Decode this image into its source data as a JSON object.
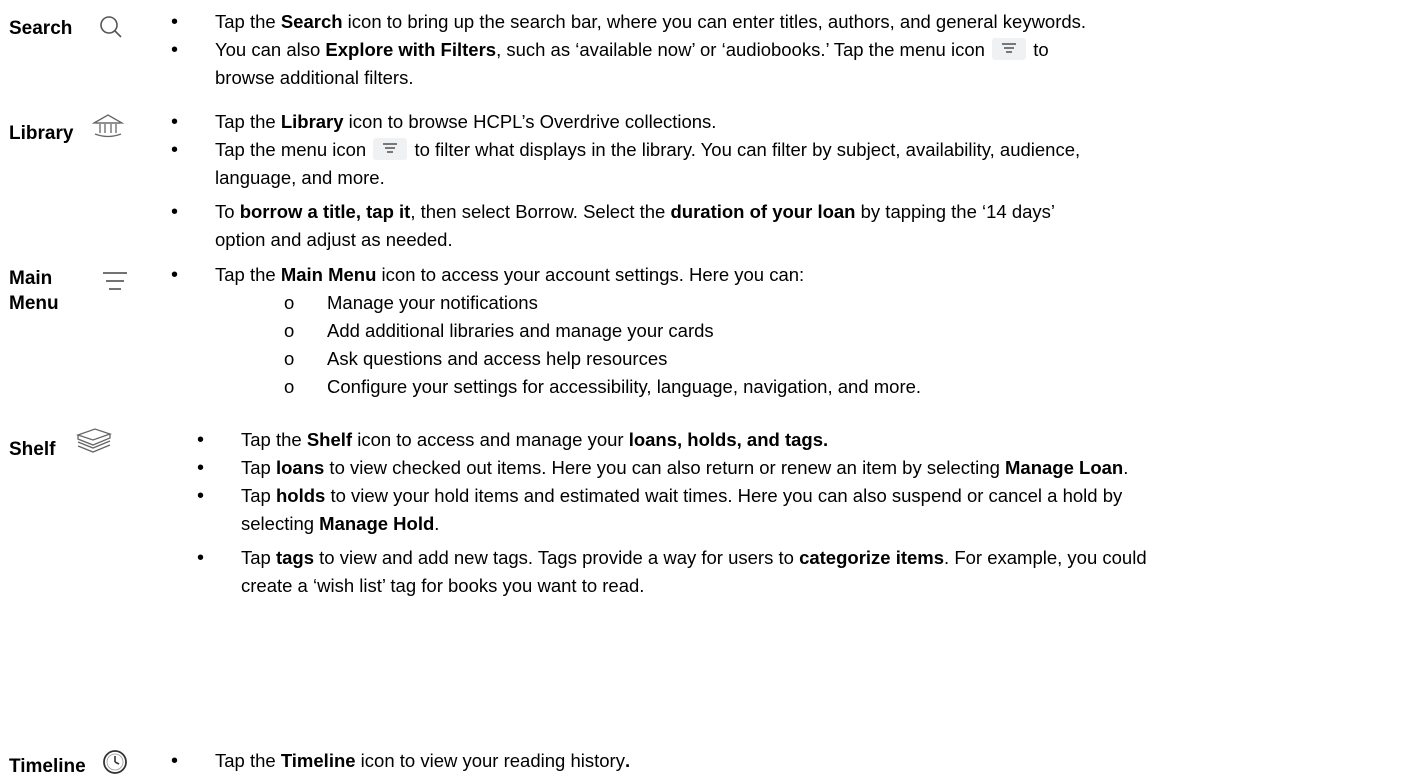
{
  "search": {
    "label": "Search",
    "icon": "magnifier-icon",
    "b1": {
      "t1": "Tap the ",
      "b1": "Search",
      "t2": " icon to bring up the search bar, where you can enter titles, authors, and general keywords."
    },
    "b2": {
      "t1": "You can also ",
      "b1": "Explore with Filters",
      "t2": ", such as ‘available now’ or ‘audiobooks.’ Tap the menu icon",
      "t3": "to",
      "t4": "browse additional filters."
    }
  },
  "library": {
    "label": "Library",
    "icon": "library-building-icon",
    "b1": {
      "t1": "Tap the ",
      "b1": "Library",
      "t2": " icon to browse HCPL’s Overdrive collections."
    },
    "b2": {
      "t1": "Tap the menu icon",
      "t2": "to filter what displays in the library. You can filter by subject, availability, audience,",
      "t3": "language, and more."
    },
    "b3": {
      "t1": "To ",
      "b1": "borrow a title, tap it",
      "t2": ", then select Borrow. Select the ",
      "b2": "duration of your loan",
      "t3": " by tapping the ‘14 days’",
      "t4": "option and adjust as needed."
    }
  },
  "main_menu": {
    "label_line1": "Main",
    "label_line2": "Menu",
    "icon": "menu-lines-icon",
    "b1": {
      "t1": "Tap the ",
      "b1": "Main Menu",
      "t2": " icon to access your account settings. Here you can:"
    },
    "subs": [
      "Manage your notifications",
      "Add additional libraries and manage your cards",
      "Ask questions and access help resources",
      "Configure your settings for accessibility, language, navigation, and more."
    ]
  },
  "shelf": {
    "label": "Shelf",
    "icon": "book-stack-icon",
    "b1": {
      "t1": "Tap the ",
      "b1": "Shelf",
      "t2": " icon to access and manage your ",
      "b2": "loans, holds, and tags."
    },
    "b2": {
      "t1": "Tap ",
      "b1": "loans",
      "t2": " to view checked out items. Here you can also return or renew an item by selecting ",
      "b2": "Manage Loan",
      "t3": "."
    },
    "b3": {
      "t1": "Tap ",
      "b1": "holds",
      "t2": " to view your hold items and estimated wait times. Here you can also suspend or cancel a hold by",
      "t3": "selecting ",
      "b2": "Manage Hold",
      "t4": "."
    },
    "b4": {
      "t1": "Tap ",
      "b1": "tags",
      "t2": " to view and add new tags. Tags provide a way for users to ",
      "b2": "categorize items",
      "t3": ". For example, you could",
      "t4": "create a ‘wish list’ tag for books you want to read."
    }
  },
  "timeline": {
    "label": "Timeline",
    "icon": "clock-icon",
    "b1": {
      "t1": "Tap the ",
      "b1": "Timeline",
      "t2": " icon to view your reading history",
      "b2": "."
    }
  }
}
